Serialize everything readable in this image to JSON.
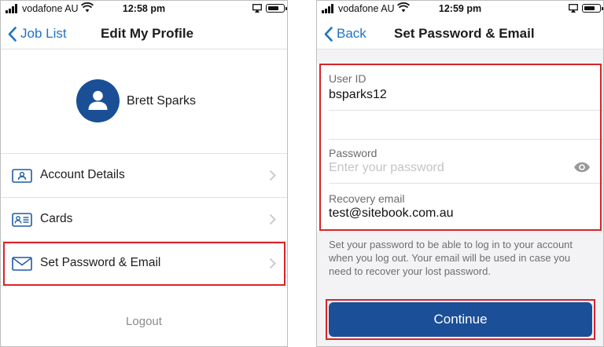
{
  "colors": {
    "accent": "#1f73c6",
    "primary_button": "#1b4f97",
    "avatar": "#1a4f96",
    "highlight": "#d8232a"
  },
  "left_screen": {
    "status_bar": {
      "carrier": "vodafone AU",
      "time": "12:58 pm"
    },
    "nav": {
      "back_label": "Job List",
      "title": "Edit My Profile"
    },
    "profile": {
      "name": "Brett Sparks",
      "avatar_icon": "person-icon"
    },
    "menu": [
      {
        "label": "Account Details",
        "icon": "id-badge-icon"
      },
      {
        "label": "Cards",
        "icon": "id-card-icon"
      },
      {
        "label": "Set Password & Email",
        "icon": "envelope-icon",
        "highlighted": true
      }
    ],
    "logout_label": "Logout"
  },
  "right_screen": {
    "status_bar": {
      "carrier": "vodafone AU",
      "time": "12:59 pm"
    },
    "nav": {
      "back_label": "Back",
      "title": "Set Password & Email"
    },
    "form": {
      "user_id": {
        "label": "User ID",
        "value": "bsparks12"
      },
      "password": {
        "label": "Password",
        "placeholder": "Enter your password",
        "value": ""
      },
      "recovery_email": {
        "label": "Recovery email",
        "value": "test@sitebook.com.au"
      }
    },
    "help_text": "Set your password to be able to log in to your account when you log out. Your email will be used in case you need to recover your lost password.",
    "continue_label": "Continue"
  }
}
